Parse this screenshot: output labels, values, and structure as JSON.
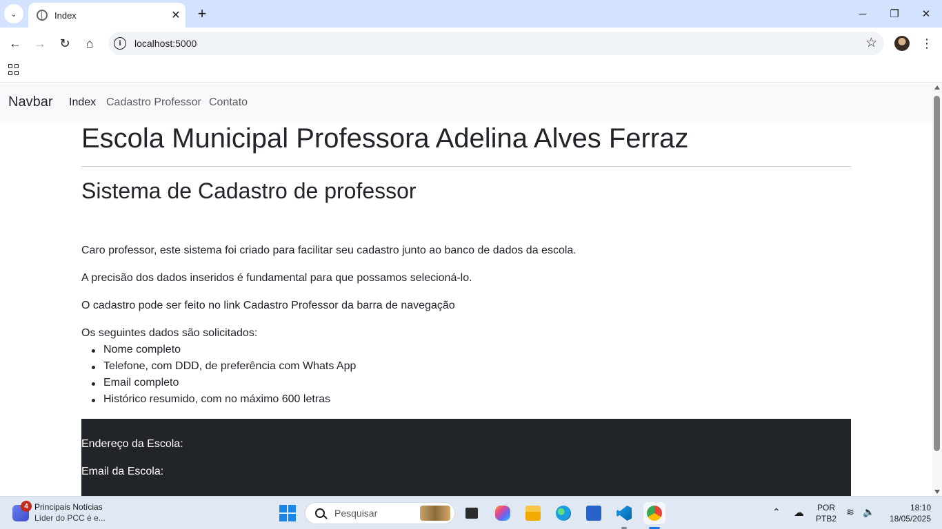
{
  "browser": {
    "tab_title": "Index",
    "url": "localhost:5000",
    "new_tab_symbol": "+",
    "close_symbol": "✕"
  },
  "site_nav": {
    "brand": "Navbar",
    "links": [
      {
        "label": "Index",
        "active": true
      },
      {
        "label": "Cadastro Professor",
        "active": false
      },
      {
        "label": "Contato",
        "active": false
      }
    ]
  },
  "main": {
    "title": "Escola Municipal Professora Adelina Alves Ferraz",
    "subtitle": "Sistema de Cadastro de professor",
    "paragraphs": [
      "Caro professor, este sistema foi criado para facilitar seu cadastro junto ao banco de dados da escola.",
      "A precisão dos dados inseridos é fundamental para que possamos selecioná-lo.",
      "O cadastro pode ser feito no link Cadastro Professor da barra de navegação",
      "Os seguintes dados são solicitados:"
    ],
    "list_items": [
      "Nome completo",
      "Telefone, com DDD, de preferência com Whats App",
      "Email completo",
      "Histórico resumido, com no máximo 600 letras"
    ]
  },
  "footer": {
    "address_label": "Endereço da Escola:",
    "email_label": "Email da Escola:"
  },
  "taskbar": {
    "news_count": "4",
    "news_title": "Principais Notícias",
    "news_subtitle": "Líder do PCC é e...",
    "search_placeholder": "Pesquisar",
    "language_line1": "POR",
    "language_line2": "PTB2",
    "time": "18:10",
    "date": "18/05/2025"
  },
  "colors": {
    "tabstrip": "#d3e3fd",
    "site_nav_bg": "#f8f9fa",
    "footer_bg": "#212529",
    "nav_active": "#212529",
    "nav_inactive": "#595c5f"
  }
}
